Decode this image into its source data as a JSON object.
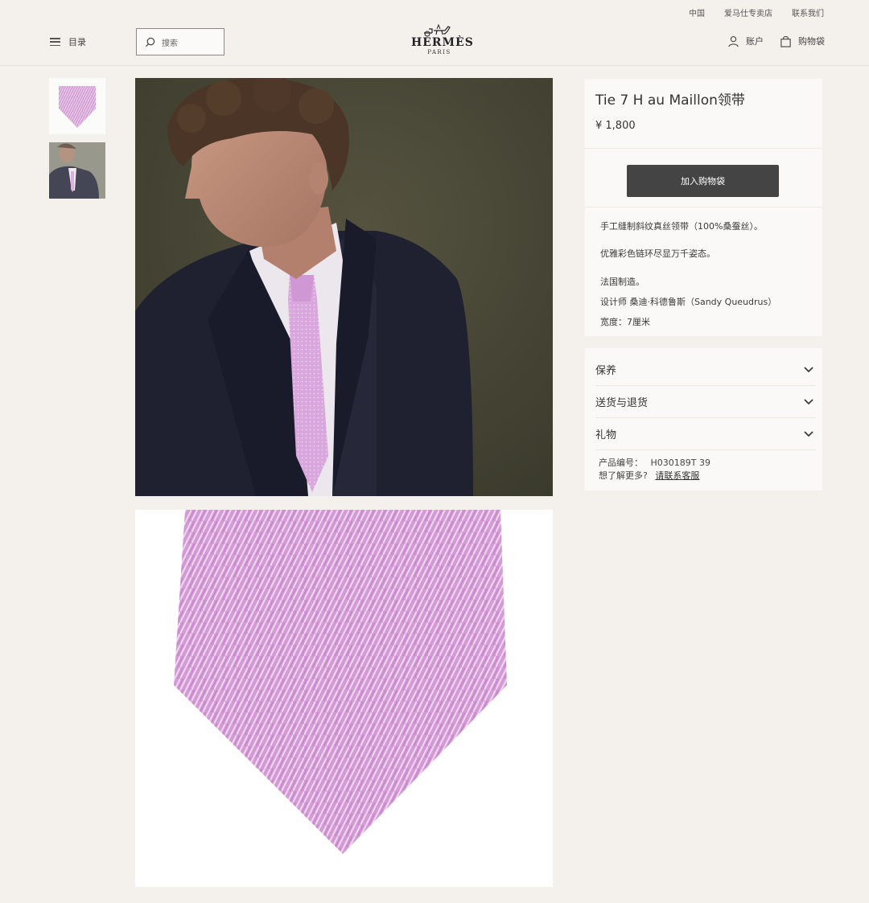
{
  "utility": {
    "region": "中国",
    "store": "爱马仕专卖店",
    "contact": "联系我们"
  },
  "header": {
    "menu_label": "目录",
    "search_placeholder": "搜索",
    "brand": "HERMÈS",
    "brand_city": "PARIS",
    "account_label": "账户",
    "bag_label": "购物袋"
  },
  "product": {
    "title": "Tie 7 H au Maillon领带",
    "price": "¥ 1,800",
    "add_to_bag": "加入购物袋",
    "description": [
      "手工缝制斜纹真丝领带（100%桑蚕丝）。",
      "优雅彩色链环尽显万千姿态。",
      "法国制造。",
      "设计师 桑迪·科德鲁斯（Sandy Queudrus）",
      "宽度：7厘米"
    ],
    "tie_color": "#d9a2da"
  },
  "accordion": [
    {
      "label": "保养"
    },
    {
      "label": "送货与退货"
    },
    {
      "label": "礼物"
    }
  ],
  "meta": {
    "sku_label": "产品编号：",
    "sku_value": "H030189T 39",
    "more_label": "想了解更多?",
    "contact_link": "请联系客服"
  }
}
